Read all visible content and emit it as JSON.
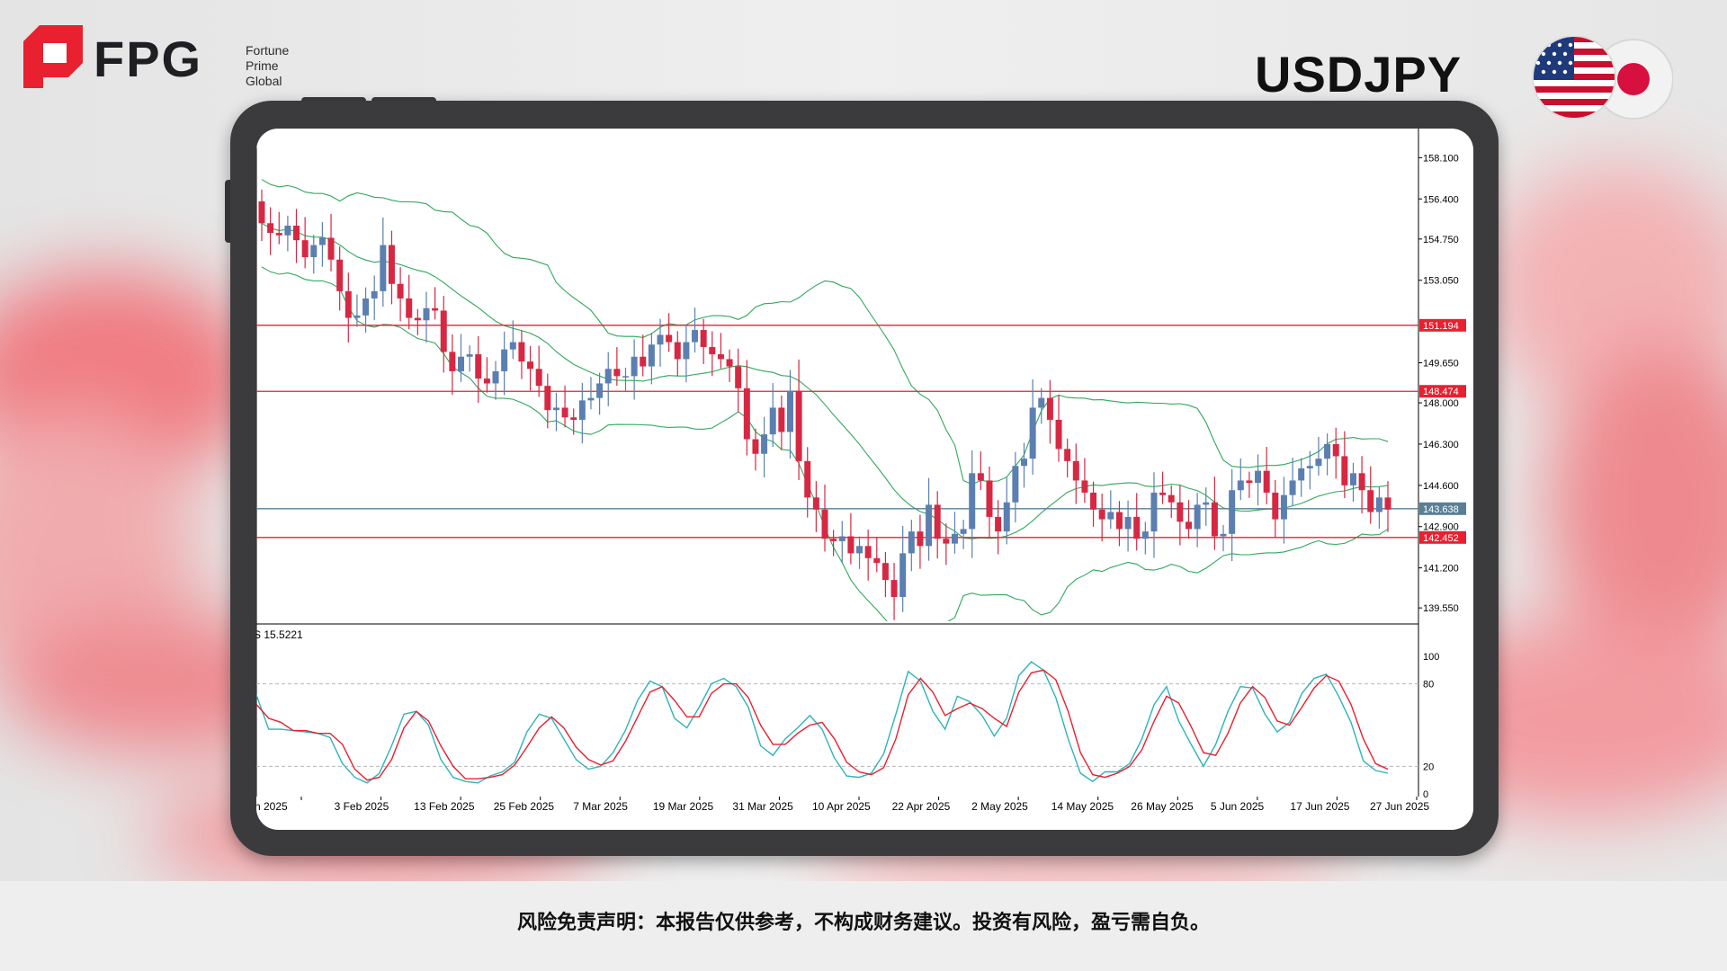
{
  "brand": {
    "name": "FPG",
    "sub_lines": [
      "Fortune",
      "Prime",
      "Global"
    ],
    "accent_color": "#e8202f"
  },
  "instrument": "USDJPY",
  "flags": [
    "us-flag-icon",
    "japan-flag-icon"
  ],
  "disclaimer": "风险免责声明：本报告仅供参考，不构成财务建议。投资有风险，盈亏需自负。",
  "chart_data": [
    {
      "type": "candlestick",
      "title": "USDJPY",
      "ylim": [
        139.0,
        159.3
      ],
      "price_ticks": [
        "158.100",
        "156.400",
        "154.750",
        "153.050",
        "149.650",
        "148.000",
        "146.300",
        "144.600",
        "142.900",
        "141.200",
        "139.550"
      ],
      "levels": [
        {
          "label": "151.194",
          "value": 151.194,
          "color": "#e8202f"
        },
        {
          "label": "148.474",
          "value": 148.474,
          "color": "#e8202f"
        },
        {
          "label": "143.638",
          "value": 143.638,
          "color": "#5a7f95"
        },
        {
          "label": "142.452",
          "value": 142.452,
          "color": "#e8202f"
        }
      ],
      "candle_colors": {
        "up": "#5b7fb0",
        "down": "#d62843"
      },
      "bollinger_color": "#2fa95a",
      "closes": [
        155.4,
        155.0,
        154.9,
        155.3,
        154.7,
        154.0,
        154.5,
        154.8,
        153.9,
        152.6,
        151.5,
        151.6,
        152.3,
        152.6,
        154.5,
        152.9,
        152.3,
        151.5,
        151.4,
        151.9,
        151.8,
        150.1,
        149.3,
        149.9,
        150.0,
        149.0,
        148.8,
        149.3,
        150.2,
        150.5,
        149.7,
        149.4,
        148.7,
        147.7,
        147.8,
        147.4,
        147.3,
        148.1,
        148.2,
        148.8,
        149.4,
        149.1,
        149.1,
        149.9,
        149.5,
        150.4,
        150.8,
        150.5,
        149.8,
        150.5,
        151.0,
        150.3,
        150.0,
        149.8,
        149.5,
        148.6,
        146.5,
        145.9,
        146.7,
        147.8,
        146.8,
        148.5,
        145.6,
        144.1,
        143.6,
        142.4,
        142.3,
        142.5,
        141.8,
        142.1,
        141.6,
        141.4,
        140.7,
        140.0,
        141.8,
        142.7,
        142.1,
        143.8,
        142.4,
        142.2,
        142.6,
        142.8,
        145.1,
        144.8,
        143.3,
        142.7,
        143.9,
        145.4,
        145.7,
        147.8,
        148.2,
        147.3,
        146.1,
        145.6,
        144.8,
        144.3,
        143.6,
        143.2,
        143.5,
        142.8,
        143.3,
        142.4,
        142.7,
        144.3,
        144.2,
        143.9,
        143.1,
        142.8,
        143.8,
        143.9,
        142.5,
        142.6,
        144.4,
        144.8,
        144.7,
        145.2,
        144.3,
        143.2,
        144.2,
        144.8,
        145.3,
        145.4,
        145.7,
        146.3,
        145.8,
        144.6,
        145.1,
        144.4,
        143.5,
        144.1,
        143.6
      ]
    },
    {
      "type": "line",
      "title": "S 15.5221",
      "ylim": [
        0,
        100
      ],
      "y_ticks": [
        "100",
        "80",
        "20",
        "0"
      ],
      "x_ticks": [
        "n 2025",
        "3 Feb 2025",
        "13 Feb 2025",
        "25 Feb 2025",
        "7 Mar 2025",
        "19 Mar 2025",
        "31 Mar 2025",
        "10 Apr 2025",
        "22 Apr 2025",
        "2 May 2025",
        "14 May 2025",
        "26 May 2025",
        "5 Jun 2025",
        "17 Jun 2025",
        "27 Jun 2025"
      ],
      "series": [
        {
          "color": "#2fb3b8",
          "values": [
            72,
            47,
            47,
            46,
            45,
            44,
            41,
            22,
            12,
            8,
            15,
            35,
            58,
            60,
            50,
            25,
            12,
            9,
            8,
            13,
            16,
            23,
            45,
            58,
            55,
            40,
            25,
            18,
            20,
            30,
            46,
            68,
            82,
            78,
            55,
            48,
            63,
            80,
            84,
            78,
            63,
            35,
            28,
            40,
            48,
            57,
            47,
            26,
            13,
            12,
            15,
            29,
            58,
            89,
            82,
            60,
            47,
            71,
            67,
            57,
            42,
            55,
            86,
            96,
            90,
            70,
            40,
            15,
            9,
            16,
            16,
            22,
            40,
            65,
            78,
            53,
            36,
            20,
            36,
            60,
            78,
            77,
            58,
            45,
            52,
            73,
            84,
            87,
            71,
            52,
            24,
            17,
            15
          ]
        },
        {
          "color": "#e8202f",
          "values": [
            65,
            55,
            52,
            46,
            46,
            44,
            44,
            36,
            18,
            10,
            12,
            25,
            48,
            60,
            53,
            35,
            20,
            11,
            11,
            12,
            14,
            21,
            34,
            48,
            56,
            48,
            34,
            25,
            21,
            24,
            38,
            56,
            74,
            78,
            68,
            56,
            56,
            73,
            80,
            80,
            70,
            50,
            36,
            36,
            44,
            50,
            52,
            40,
            23,
            16,
            14,
            19,
            40,
            72,
            84,
            74,
            57,
            62,
            66,
            62,
            55,
            49,
            74,
            88,
            90,
            83,
            60,
            30,
            14,
            12,
            15,
            20,
            32,
            53,
            71,
            66,
            49,
            30,
            28,
            44,
            66,
            78,
            70,
            53,
            50,
            63,
            77,
            86,
            82,
            65,
            40,
            22,
            18
          ]
        }
      ]
    }
  ]
}
